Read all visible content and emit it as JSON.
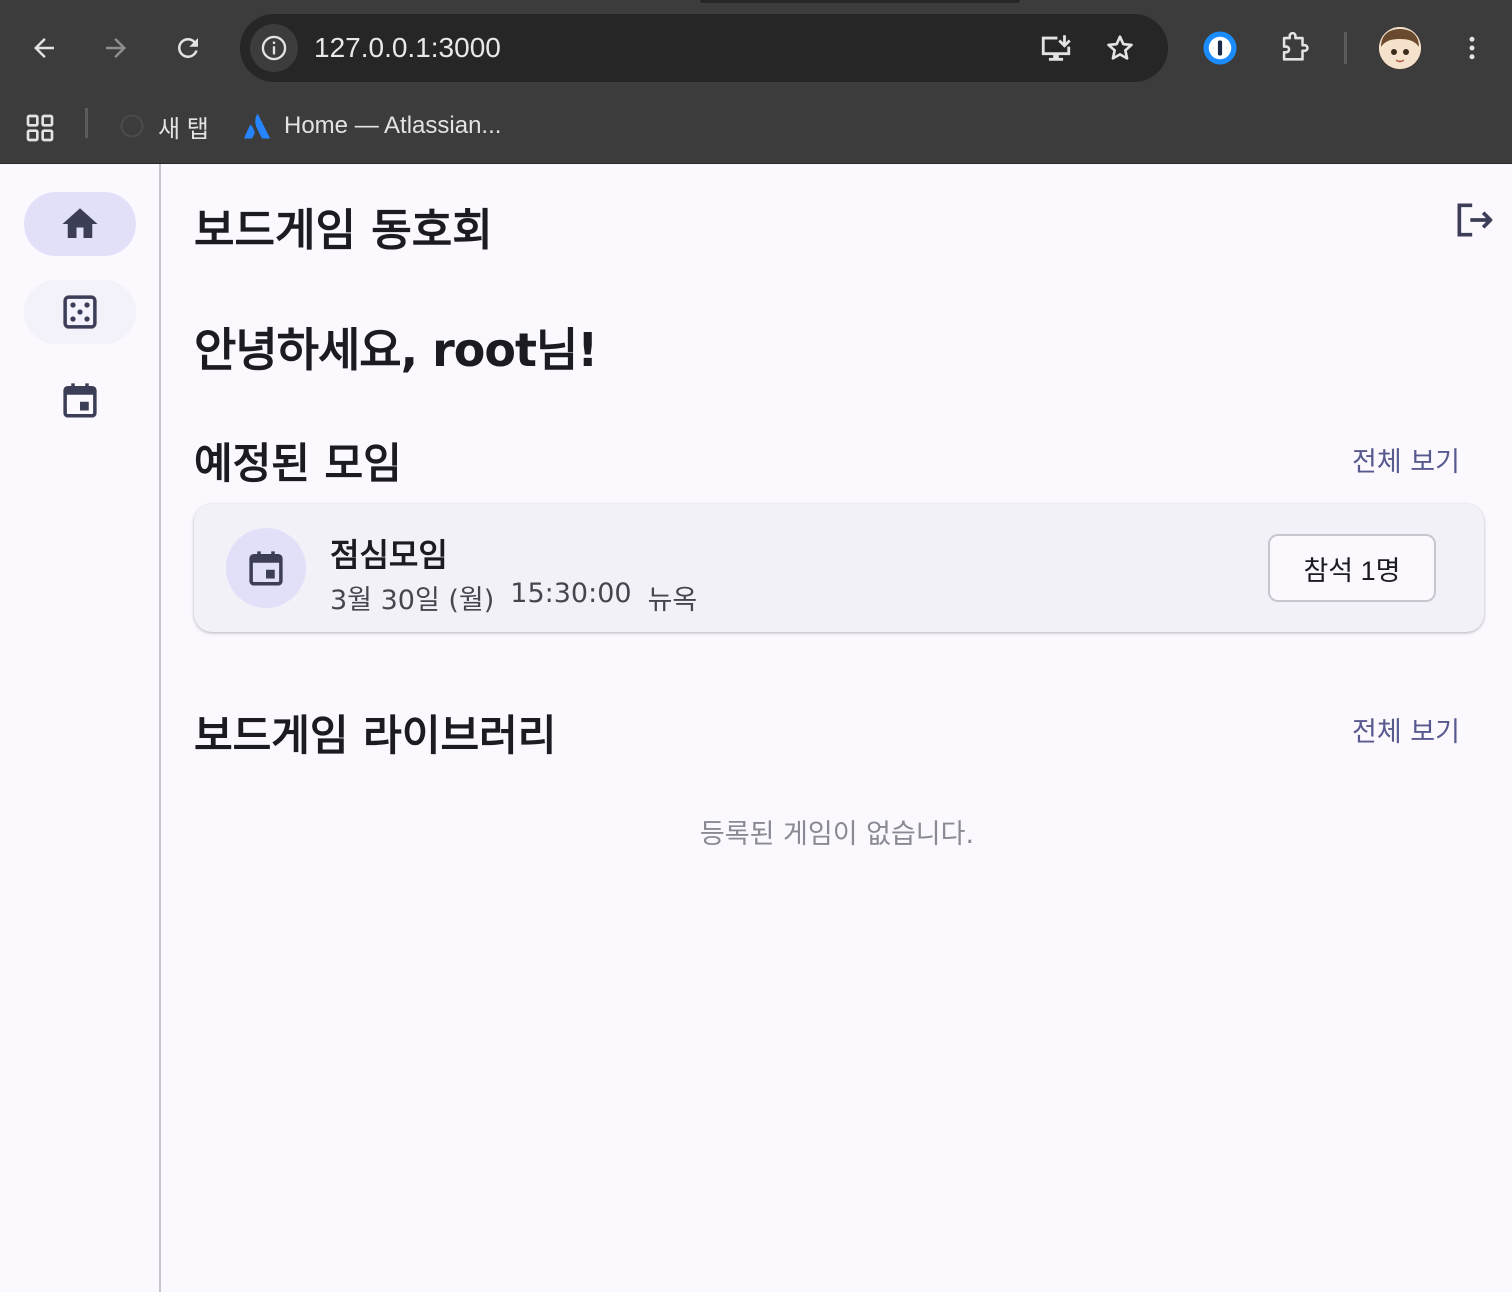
{
  "browser": {
    "url": "127.0.0.1:3000",
    "bookmarks": [
      {
        "label": "새 탭"
      },
      {
        "label": "Home — Atlassian..."
      }
    ]
  },
  "app": {
    "title": "보드게임 동호회",
    "greeting": "안녕하세요, root님!",
    "nav": [
      {
        "icon": "home-icon",
        "active": true
      },
      {
        "icon": "dice-icon",
        "active": false
      },
      {
        "icon": "calendar-icon",
        "active": false
      }
    ],
    "meetings_section": {
      "title": "예정된 모임",
      "see_all": "전체 보기",
      "items": [
        {
          "name": "점심모임",
          "date": "3월 30일 (월)",
          "time": "15:30:00",
          "location": "뉴옥",
          "attend_label": "참석 1명"
        }
      ]
    },
    "library_section": {
      "title": "보드게임 라이브러리",
      "see_all": "전체 보기",
      "empty_message": "등록된 게임이 없습니다."
    }
  },
  "colors": {
    "accent": "#585a8f",
    "accent_container": "#e2e0f9",
    "background": "#fbf8fe",
    "chrome": "#3c3c3c"
  }
}
